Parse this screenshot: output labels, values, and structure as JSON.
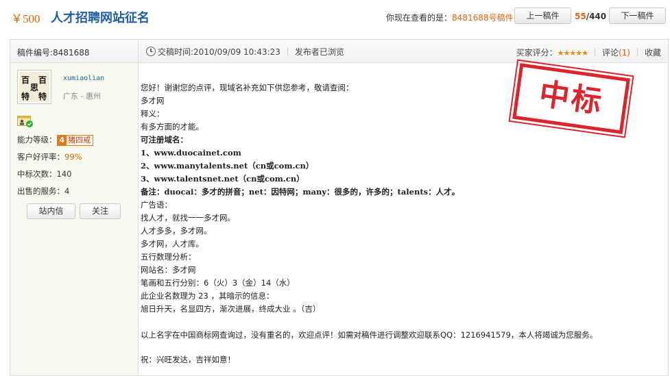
{
  "header": {
    "price": "￥500",
    "title": "人才招聘网站征名",
    "viewing_label": "你现在查看的是：",
    "viewing_value": "8481688号稿件",
    "prev_label": "上一稿件",
    "counter_current": "55",
    "counter_total": "/440",
    "next_label": "下一稿件"
  },
  "panel": {
    "draft_id": "稿件编号:8481688",
    "submit_time": "交稿时间:2010/09/09 10:43:23",
    "publisher_viewed": "发布者已浏览",
    "rating_label": "买家评分：",
    "rating_stars": "★★★★★",
    "comment_label": "评论",
    "comment_count": "(1)",
    "favorite_label": "收藏"
  },
  "user": {
    "avatar_chars": [
      "百",
      "百",
      "思",
      "特",
      "特"
    ],
    "name": "xumiaolian",
    "location": "广东 - 惠州",
    "level_label": "能力等级：",
    "level_num": "4",
    "level_name": "猪四戒",
    "rate_label": "客户好评率：",
    "rate_value": "99%",
    "wins_label": "中标次数：",
    "wins_value": "140",
    "services_label": "出售的服务：",
    "services_value": "4",
    "msg_button": "站内信",
    "follow_button": "关注"
  },
  "stamp_text": "中标",
  "content": {
    "lines": [
      "您好！谢谢您的点评，现域名补充如下供您参考，敬请查阅：",
      "多才网",
      "释义：",
      "有多方面的才能。",
      "可注册域名：",
      "1、www.duocainet.com",
      "2、www.manytalents.net（cn或com.cn）",
      "3、www.talentsnet.net（cn或com.cn）",
      "备注：duocai：多才的拼音；net：因特网；many：很多的，许多的；talents：人才。",
      "广告语：",
      "找人才，就找一一多才网。",
      "人才多多，多才网。",
      "多才网，人才库。",
      "五行数理分析：",
      "网站名：多才网",
      "笔画和五行分别：6（火）3（金）14（水）",
      "此企业名数理为 23 ，其暗示的信息：",
      "旭日升天，名显四方，渐次进展，终成大业 。（吉）",
      "以上名字在中国商标网查询过，没有重名的，欢迎点评！如需对稿件进行调整欢迎联系QQ：1216941579，本人将竭诚为您服务。",
      "祝：兴旺发达，吉祥如意！"
    ]
  }
}
